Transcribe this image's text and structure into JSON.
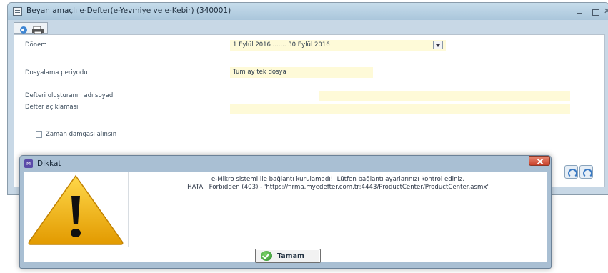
{
  "main_window": {
    "title": "Beyan amaçlı e-Defter(e-Yevmiye ve e-Kebir) (340001)",
    "form": {
      "donem_label": "Dönem",
      "donem_value": "1 Eylül 2016 ....... 30 Eylül 2016",
      "dosyalama_label": "Dosyalama periyodu",
      "dosyalama_value": "Tüm ay tek dosya",
      "olusturan_label": "Defteri oluşturanın adı soyadı",
      "olusturan_value": "",
      "aciklama_label": "Defter açıklaması",
      "aciklama_value": "",
      "zaman_damgasi_label": "Zaman damgası alınsın"
    }
  },
  "dialog": {
    "title": "Dikkat",
    "message_line1": "e-Mikro sistemi ile bağlantı kurulamadı!. Lütfen bağlantı ayarlarınızı kontrol ediniz.",
    "message_line2": "HATA : Forbidden (403) - 'https://firma.myedefter.com.tr:4443/ProductCenter/ProductCenter.asmx'",
    "ok_label": "Tamam",
    "app_icon_label": "M"
  },
  "colors": {
    "field_fill": "#fefad8",
    "warning_yellow": "#f4b400",
    "close_red": "#c8402a"
  },
  "icons": [
    "window-icon",
    "back-icon",
    "print-icon",
    "dropdown-arrow-icon",
    "warning-icon",
    "check-icon",
    "close-icon"
  ]
}
